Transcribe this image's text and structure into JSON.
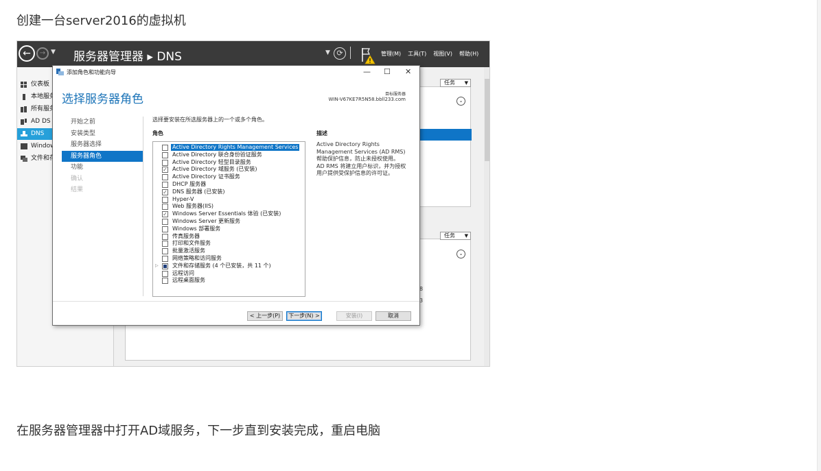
{
  "article": {
    "title": "创建一台server2016的虚拟机",
    "caption": "在服务器管理器中打开AD域服务，下一步直到安装完成，重启电脑"
  },
  "server_manager": {
    "title": "服务器管理器 ▸ DNS",
    "menus": [
      "管理(M)",
      "工具(T)",
      "视图(V)",
      "帮助(H)"
    ],
    "nav": [
      {
        "label": "仪表板",
        "icon": "dashboard-icon"
      },
      {
        "label": "本地服务器",
        "icon": "server-icon"
      },
      {
        "label": "所有服务器",
        "icon": "servers-icon"
      },
      {
        "label": "AD DS",
        "icon": "ad-ds-icon"
      },
      {
        "label": "DNS",
        "icon": "dns-icon",
        "active": true
      },
      {
        "label": "Windows",
        "icon": "windows-icon"
      },
      {
        "label": "文件和存储",
        "icon": "file-storage-icon"
      }
    ],
    "task_button": "任务",
    "fragments": [
      "8",
      "3"
    ]
  },
  "wizard": {
    "window_title": "添加角色和功能向导",
    "heading": "选择服务器角色",
    "target_label": "目标服务器",
    "target_server": "WIN-V67KE7R5N58.bbll233.com",
    "steps": [
      {
        "label": "开始之前",
        "state": "normal"
      },
      {
        "label": "安装类型",
        "state": "normal"
      },
      {
        "label": "服务器选择",
        "state": "normal"
      },
      {
        "label": "服务器角色",
        "state": "active"
      },
      {
        "label": "功能",
        "state": "normal"
      },
      {
        "label": "确认",
        "state": "disabled"
      },
      {
        "label": "结果",
        "state": "disabled"
      }
    ],
    "instruction": "选择要安装在所选服务器上的一个或多个角色。",
    "roles_header": "角色",
    "description_header": "描述",
    "roles": [
      {
        "label": "Active Directory Rights Management Services",
        "checked": false,
        "selected": true
      },
      {
        "label": "Active Directory 联合身份验证服务",
        "checked": false
      },
      {
        "label": "Active Directory 轻型目录服务",
        "checked": false
      },
      {
        "label": "Active Directory 域服务 (已安装)",
        "checked": true
      },
      {
        "label": "Active Directory 证书服务",
        "checked": false
      },
      {
        "label": "DHCP 服务器",
        "checked": false
      },
      {
        "label": "DNS 服务器 (已安装)",
        "checked": true
      },
      {
        "label": "Hyper-V",
        "checked": false
      },
      {
        "label": "Web 服务器(IIS)",
        "checked": false
      },
      {
        "label": "Windows Server Essentials 体验 (已安装)",
        "checked": true
      },
      {
        "label": "Windows Server 更新服务",
        "checked": false
      },
      {
        "label": "Windows 部署服务",
        "checked": false
      },
      {
        "label": "传真服务器",
        "checked": false
      },
      {
        "label": "打印和文件服务",
        "checked": false
      },
      {
        "label": "批量激活服务",
        "checked": false
      },
      {
        "label": "网络策略和访问服务",
        "checked": false
      },
      {
        "label": "文件和存储服务 (4 个已安装，共 11 个)",
        "checked": "partial",
        "expandable": true
      },
      {
        "label": "远程访问",
        "checked": false
      },
      {
        "label": "远程桌面服务",
        "checked": false
      }
    ],
    "description": "Active Directory Rights\nManagement Services (AD RMS)\n帮助保护信息，防止未授权使用。\nAD RMS 将建立用户标识，并为授权\n用户提供受保护信息的许可证。",
    "buttons": {
      "prev": "< 上一步(P)",
      "next": "下一步(N) >",
      "install": "安装(I)",
      "cancel": "取消"
    }
  }
}
